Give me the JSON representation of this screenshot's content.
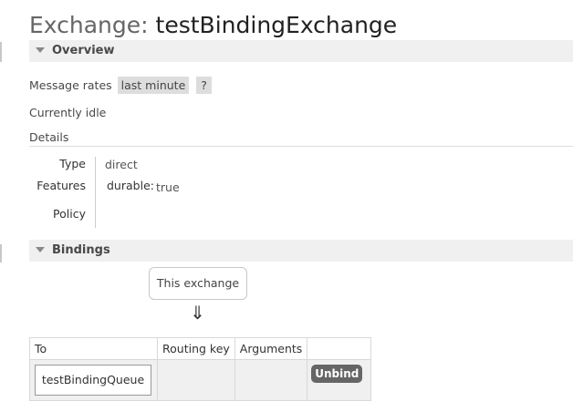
{
  "page": {
    "title_prefix": "Exchange:",
    "title_name": "testBindingExchange"
  },
  "overview": {
    "header": "Overview",
    "message_rates_label": "Message rates",
    "rate_period": "last minute",
    "help_label": "?",
    "idle_text": "Currently idle",
    "details_label": "Details",
    "details": {
      "type_label": "Type",
      "type_value": "direct",
      "features_label": "Features",
      "feature_name": "durable:",
      "feature_value": "true",
      "policy_label": "Policy",
      "policy_value": ""
    }
  },
  "bindings": {
    "header": "Bindings",
    "source_label": "This exchange",
    "arrow": "⇓",
    "columns": [
      "To",
      "Routing key",
      "Arguments",
      ""
    ],
    "rows": [
      {
        "to": "testBindingQueue",
        "routing_key": "",
        "arguments": "",
        "action": "Unbind"
      }
    ]
  },
  "colors": {
    "section_bg": "#f0f0f0",
    "pill_bg": "#dddddd",
    "button_bg": "#666666",
    "text": "#484848"
  }
}
